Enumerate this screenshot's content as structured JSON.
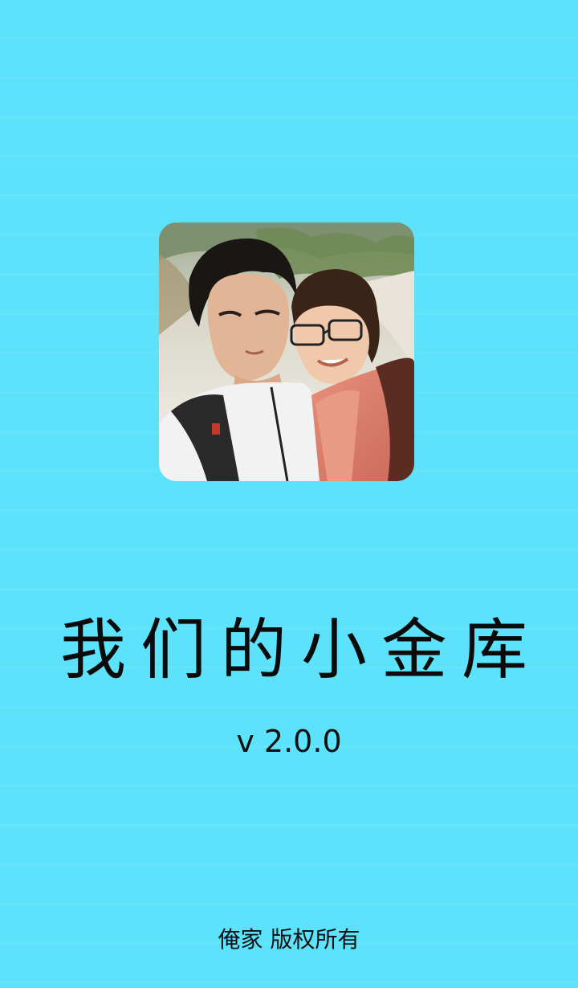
{
  "app": {
    "title": "我们的小金库",
    "version": "v 2.0.0",
    "copyright": "俺家 版权所有"
  },
  "photo": {
    "icon": "couple-photo"
  },
  "colors": {
    "background": "#5ce3fb",
    "text": "#111111"
  }
}
